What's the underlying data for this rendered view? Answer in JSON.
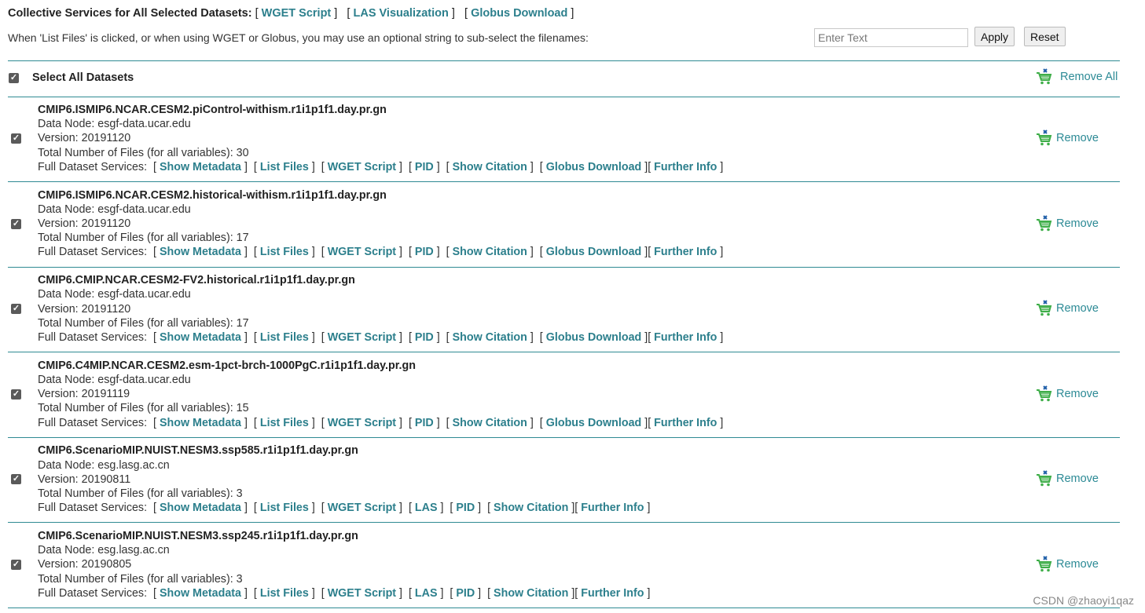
{
  "header": {
    "collective_label": "Collective Services for All Selected Datasets:",
    "collective_links": [
      "WGET Script",
      "LAS Visualization",
      "Globus Download"
    ],
    "filter_hint": "When 'List Files' is clicked, or when using WGET or Globus, you may use an optional string to sub-select the filenames:",
    "filter_placeholder": "Enter Text",
    "apply_label": "Apply",
    "reset_label": "Reset"
  },
  "select_all": {
    "label": "Select All Datasets",
    "checked": true
  },
  "remove_all_label": "Remove All",
  "remove_label": "Remove",
  "services_label": "Full Dataset Services:",
  "datasets": [
    {
      "title": "CMIP6.ISMIP6.NCAR.CESM2.piControl-withism.r1i1p1f1.day.pr.gn",
      "data_node": "Data Node: esgf-data.ucar.edu",
      "version": "Version: 20191120",
      "files": "Total Number of Files (for all variables): 30",
      "services": [
        "Show Metadata",
        "List Files",
        "WGET Script",
        "PID",
        "Show Citation",
        "Globus Download",
        "Further Info"
      ]
    },
    {
      "title": "CMIP6.ISMIP6.NCAR.CESM2.historical-withism.r1i1p1f1.day.pr.gn",
      "data_node": "Data Node: esgf-data.ucar.edu",
      "version": "Version: 20191120",
      "files": "Total Number of Files (for all variables): 17",
      "services": [
        "Show Metadata",
        "List Files",
        "WGET Script",
        "PID",
        "Show Citation",
        "Globus Download",
        "Further Info"
      ]
    },
    {
      "title": "CMIP6.CMIP.NCAR.CESM2-FV2.historical.r1i1p1f1.day.pr.gn",
      "data_node": "Data Node: esgf-data.ucar.edu",
      "version": "Version: 20191120",
      "files": "Total Number of Files (for all variables): 17",
      "services": [
        "Show Metadata",
        "List Files",
        "WGET Script",
        "PID",
        "Show Citation",
        "Globus Download",
        "Further Info"
      ]
    },
    {
      "title": "CMIP6.C4MIP.NCAR.CESM2.esm-1pct-brch-1000PgC.r1i1p1f1.day.pr.gn",
      "data_node": "Data Node: esgf-data.ucar.edu",
      "version": "Version: 20191119",
      "files": "Total Number of Files (for all variables): 15",
      "services": [
        "Show Metadata",
        "List Files",
        "WGET Script",
        "PID",
        "Show Citation",
        "Globus Download",
        "Further Info"
      ]
    },
    {
      "title": "CMIP6.ScenarioMIP.NUIST.NESM3.ssp585.r1i1p1f1.day.pr.gn",
      "data_node": "Data Node: esg.lasg.ac.cn",
      "version": "Version: 20190811",
      "files": "Total Number of Files (for all variables): 3",
      "services": [
        "Show Metadata",
        "List Files",
        "WGET Script",
        "LAS",
        "PID",
        "Show Citation",
        "Further Info"
      ]
    },
    {
      "title": "CMIP6.ScenarioMIP.NUIST.NESM3.ssp245.r1i1p1f1.day.pr.gn",
      "data_node": "Data Node: esg.lasg.ac.cn",
      "version": "Version: 20190805",
      "files": "Total Number of Files (for all variables): 3",
      "services": [
        "Show Metadata",
        "List Files",
        "WGET Script",
        "LAS",
        "PID",
        "Show Citation",
        "Further Info"
      ]
    }
  ],
  "watermark": "CSDN @zhaoyi1qaz",
  "colors": {
    "link": "#2c7f8c",
    "divider": "#2f8a93",
    "cart": "#3fae49",
    "cart_x": "#1f5fa8"
  }
}
